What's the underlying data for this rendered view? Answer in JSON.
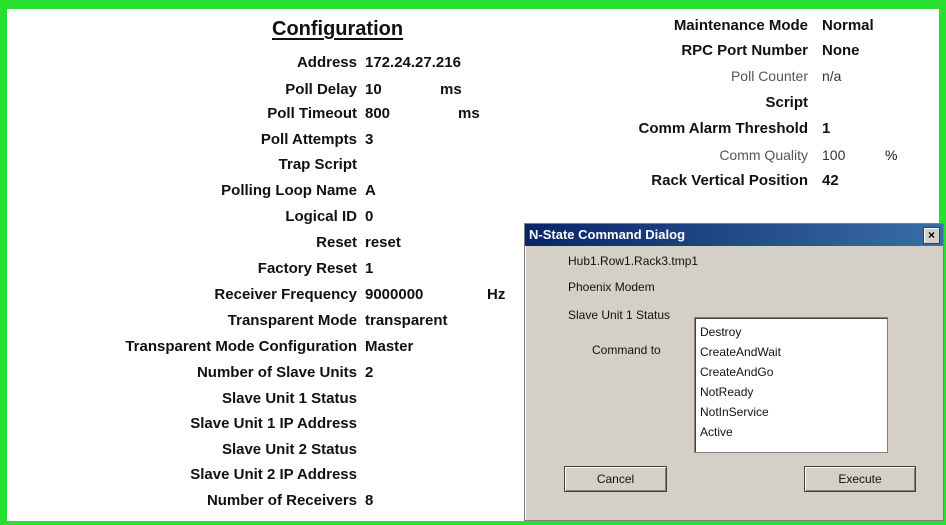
{
  "config": {
    "title": "Configuration",
    "fields": [
      {
        "label": "Address",
        "value": "172.24.27.216",
        "unit": ""
      },
      {
        "label": "Poll Delay",
        "value": "10",
        "unit": "ms"
      },
      {
        "label": "Poll Timeout",
        "value": "800",
        "unit": "ms"
      },
      {
        "label": "Poll Attempts",
        "value": "3",
        "unit": ""
      },
      {
        "label": "Trap Script",
        "value": "",
        "unit": ""
      },
      {
        "label": "Polling Loop Name",
        "value": "A",
        "unit": ""
      },
      {
        "label": "Logical ID",
        "value": "0",
        "unit": ""
      },
      {
        "label": "Reset",
        "value": "reset",
        "unit": ""
      },
      {
        "label": "Factory Reset",
        "value": "1",
        "unit": ""
      },
      {
        "label": "Receiver Frequency",
        "value": "9000000",
        "unit": "Hz"
      },
      {
        "label": "Transparent Mode",
        "value": "transparent",
        "unit": ""
      },
      {
        "label": "Transparent Mode Configuration",
        "value": "Master",
        "unit": ""
      },
      {
        "label": "Number of Slave Units",
        "value": "2",
        "unit": ""
      },
      {
        "label": "Slave Unit 1 Status",
        "value": "",
        "unit": ""
      },
      {
        "label": "Slave Unit 1 IP Address",
        "value": "",
        "unit": ""
      },
      {
        "label": "Slave Unit 2 Status",
        "value": "",
        "unit": ""
      },
      {
        "label": "Slave Unit 2 IP Address",
        "value": "",
        "unit": ""
      },
      {
        "label": "Number of Receivers",
        "value": "8",
        "unit": ""
      }
    ]
  },
  "right": {
    "fields": [
      {
        "label": "Maintenance Mode",
        "value": "Normal",
        "unit": ""
      },
      {
        "label": "RPC Port Number",
        "value": "None",
        "unit": ""
      },
      {
        "label": "Poll Counter",
        "value": "n/a",
        "unit": ""
      },
      {
        "label": "Script",
        "value": "",
        "unit": ""
      },
      {
        "label": "Comm Alarm Threshold",
        "value": "1",
        "unit": ""
      },
      {
        "label": "Comm Quality",
        "value": "100",
        "unit": "%"
      },
      {
        "label": "Rack Vertical Position",
        "value": "42",
        "unit": ""
      }
    ]
  },
  "dialog": {
    "title": "N-State Command Dialog",
    "close": "×",
    "path": "Hub1.Row1.Rack3.tmp1",
    "device": "Phoenix Modem",
    "attribute": "Slave Unit 1 Status",
    "command_label": "Command to",
    "options": [
      "Destroy",
      "CreateAndWait",
      "CreateAndGo",
      "NotReady",
      "NotInService",
      "Active"
    ],
    "cancel": "Cancel",
    "execute": "Execute"
  },
  "colors": {
    "border": "#29e02f",
    "titlebar": "#0a246a",
    "dialog_bg": "#d4d0c8"
  }
}
